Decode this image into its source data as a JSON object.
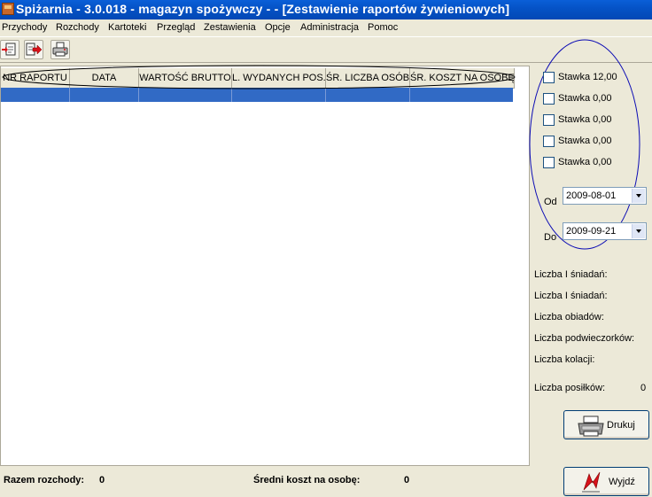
{
  "window": {
    "title": "Spiżarnia - 3.0.018 - magazyn spożywczy -  - [Zestawienie raportów żywieniowych]"
  },
  "menu": [
    "Przychody",
    "Rozchody",
    "Kartoteki",
    "Przegląd",
    "Zestawienia",
    "Opcje",
    "Administracja",
    "Pomoc"
  ],
  "toolbar": {
    "icons": [
      "new-document-icon",
      "export-icon",
      "print-icon"
    ]
  },
  "grid": {
    "columns": [
      "NR RAPORTU",
      "DATA",
      "WARTOŚĆ BRUTTO",
      "L. WYDANYCH POS.",
      "ŚR. LICZBA OSÓB",
      "ŚR. KOSZT NA OSOBĘ"
    ],
    "rows": [
      [
        "",
        "",
        "",
        "",
        "",
        ""
      ]
    ]
  },
  "rates": [
    "Stawka 12,00",
    "Stawka 0,00",
    "Stawka 0,00",
    "Stawka 0,00",
    "Stawka 0,00"
  ],
  "date_from": {
    "label": "Od",
    "value": "2009-08-01"
  },
  "date_to": {
    "label": "Do",
    "value": "2009-09-21"
  },
  "stats": {
    "breakfast1": "Liczba I śniadań:",
    "breakfast2": "Liczba I śniadań:",
    "lunch": "Liczba obiadów:",
    "afternoon": "Liczba podwieczorków:",
    "dinner": "Liczba kolacji:",
    "meals_label": "Liczba posiłków:",
    "meals_value": "0"
  },
  "buttons": {
    "print": "Drukuj",
    "exit": "Wyjdź"
  },
  "summary": {
    "total_label": "Razem rozchody:",
    "total_value": "0",
    "avg_label": "Średni koszt na osobę:",
    "avg_value": "0"
  },
  "colors": {
    "title_bar": "#0553c7",
    "selection": "#316ac5",
    "annotation": "#0a0ab4"
  }
}
